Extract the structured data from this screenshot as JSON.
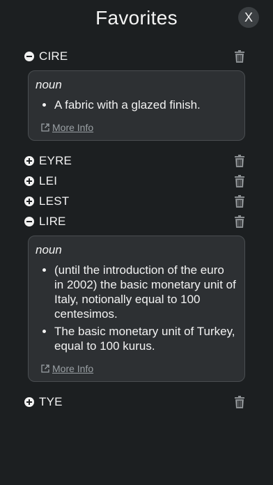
{
  "header": {
    "title": "Favorites",
    "close_label": "X"
  },
  "entries": [
    {
      "word": "CIRE",
      "expanded": true,
      "pos": "noun",
      "definitions": [
        "A fabric with a glazed finish."
      ],
      "more_info": "More Info"
    },
    {
      "word": "EYRE",
      "expanded": false
    },
    {
      "word": "LEI",
      "expanded": false
    },
    {
      "word": "LEST",
      "expanded": false
    },
    {
      "word": "LIRE",
      "expanded": true,
      "pos": "noun",
      "definitions": [
        "(until the introduction of the euro in 2002) the basic monetary unit of Italy, notionally equal to 100 centesimos.",
        "The basic monetary unit of Turkey, equal to 100 kurus."
      ],
      "more_info": "More Info"
    },
    {
      "word": "TYE",
      "expanded": false
    }
  ],
  "icons": {
    "expand": "plus-circle-icon",
    "collapse": "minus-circle-icon",
    "delete": "trash-icon",
    "external": "external-link-icon"
  },
  "colors": {
    "background": "#1c1f21",
    "card": "#2d3033",
    "icon": "#8a8e91",
    "link": "#9aa0a4"
  }
}
